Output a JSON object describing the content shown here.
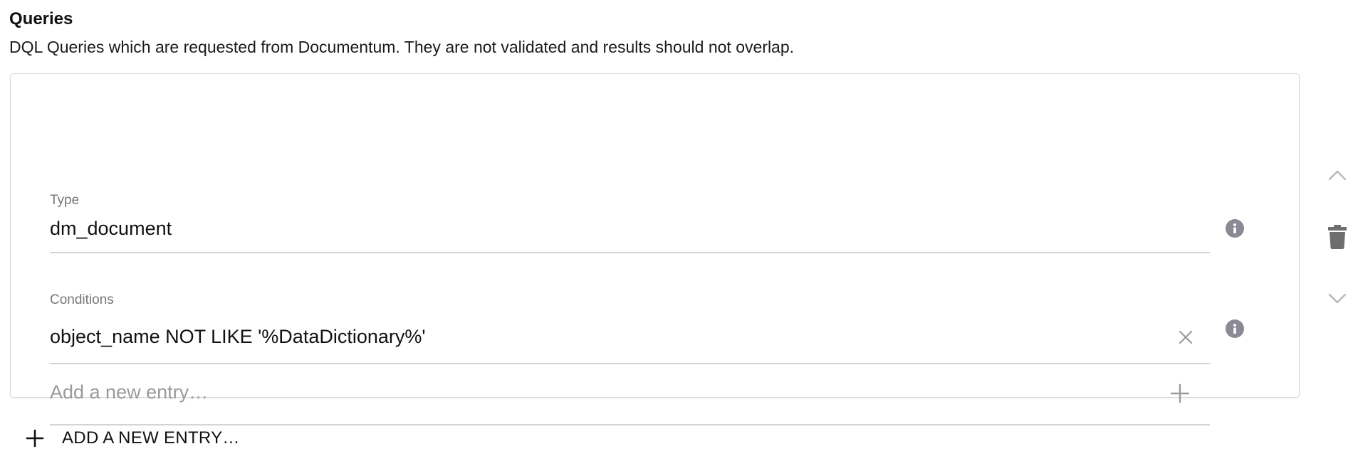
{
  "section": {
    "title": "Queries",
    "description": "DQL Queries which are requested from Documentum. They are not validated and results should not overlap."
  },
  "entry": {
    "type_field": {
      "label": "Type",
      "value": "dm_document"
    },
    "conditions_field": {
      "label": "Conditions",
      "items": [
        "object_name NOT LIKE '%DataDictionary%'"
      ],
      "new_entry_placeholder": "Add a new entry…"
    }
  },
  "footer": {
    "add_entry_label": "ADD A NEW ENTRY…"
  },
  "icons": {
    "info": "info-icon",
    "move_up": "chevron-up-icon",
    "delete": "trash-icon",
    "move_down": "chevron-down-icon",
    "clear": "close-icon",
    "add": "plus-icon"
  },
  "colors": {
    "info_icon_bg": "#8a8a96",
    "label": "#767676",
    "placeholder": "#9a9a9a",
    "divider": "#d4d4d4"
  }
}
